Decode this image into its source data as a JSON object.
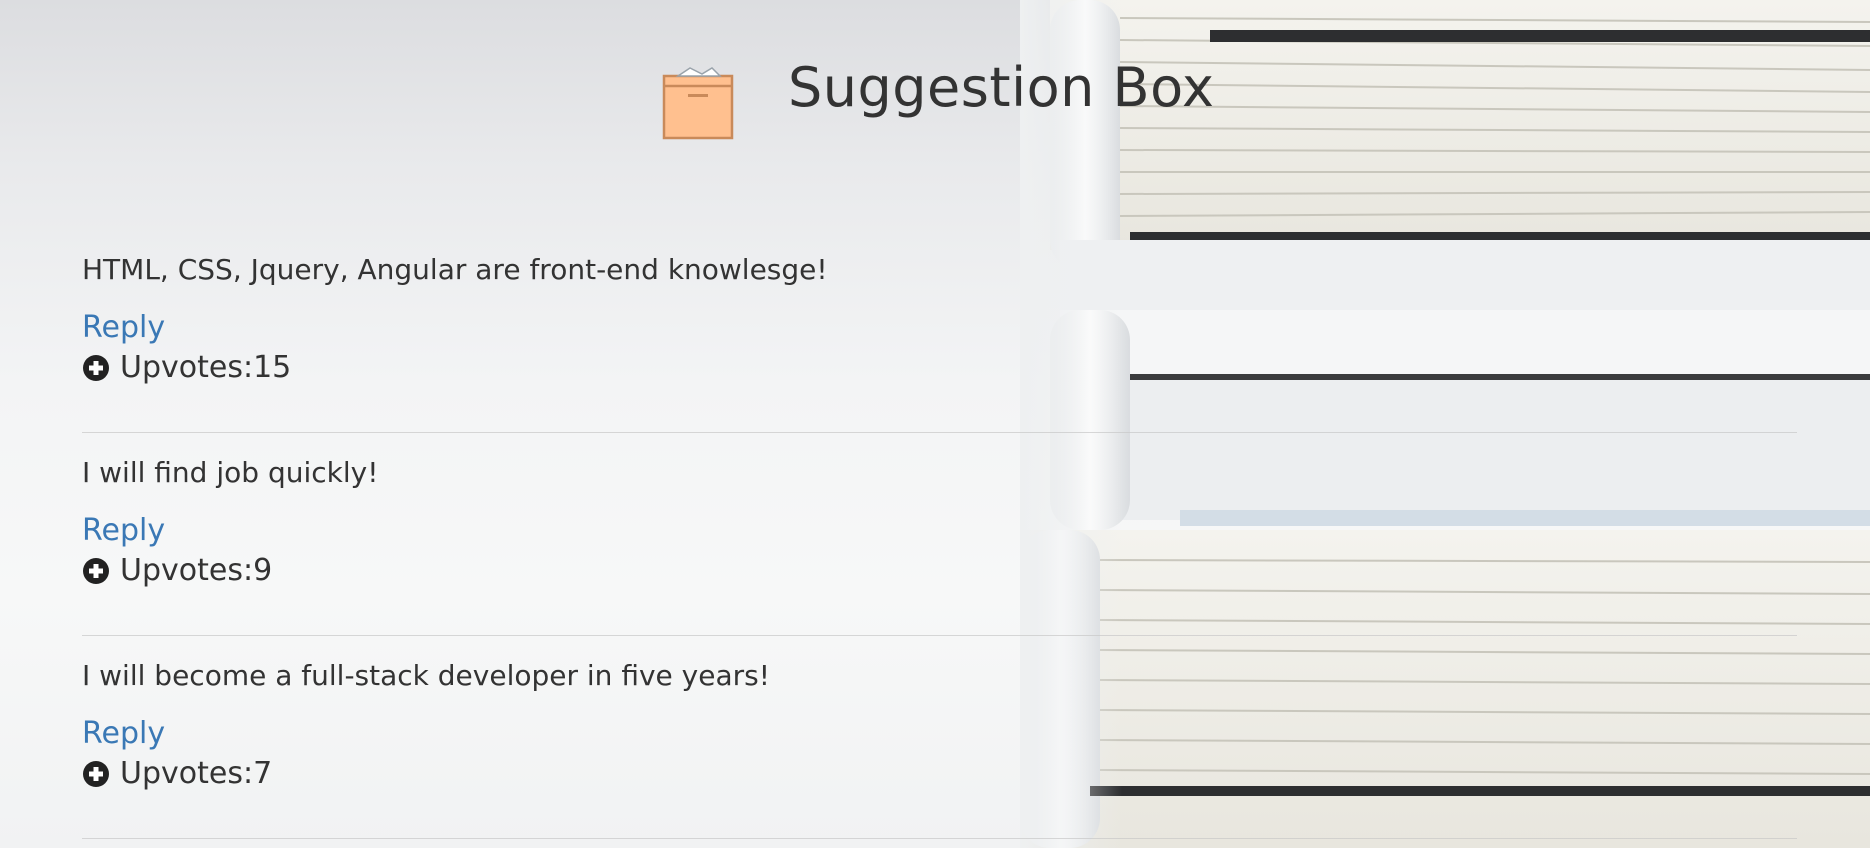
{
  "header": {
    "title": "Suggestion Box",
    "icon": "box-icon"
  },
  "suggestions": [
    {
      "text": "HTML, CSS, Jquery, Angular are front-end knowlesge!",
      "reply_label": "Reply",
      "upvotes_label": "Upvotes:15",
      "upvotes": 15
    },
    {
      "text": "I will find job quickly!",
      "reply_label": "Reply",
      "upvotes_label": "Upvotes:9",
      "upvotes": 9
    },
    {
      "text": "I will become a full-stack developer in five years!",
      "reply_label": "Reply",
      "upvotes_label": "Upvotes:7",
      "upvotes": 7
    }
  ],
  "icons": {
    "upvote": "plus-circle-icon"
  },
  "colors": {
    "link": "#3a78b5",
    "text": "#333333",
    "box_fill": "#ffc08f",
    "box_stroke": "#c98a5a"
  }
}
